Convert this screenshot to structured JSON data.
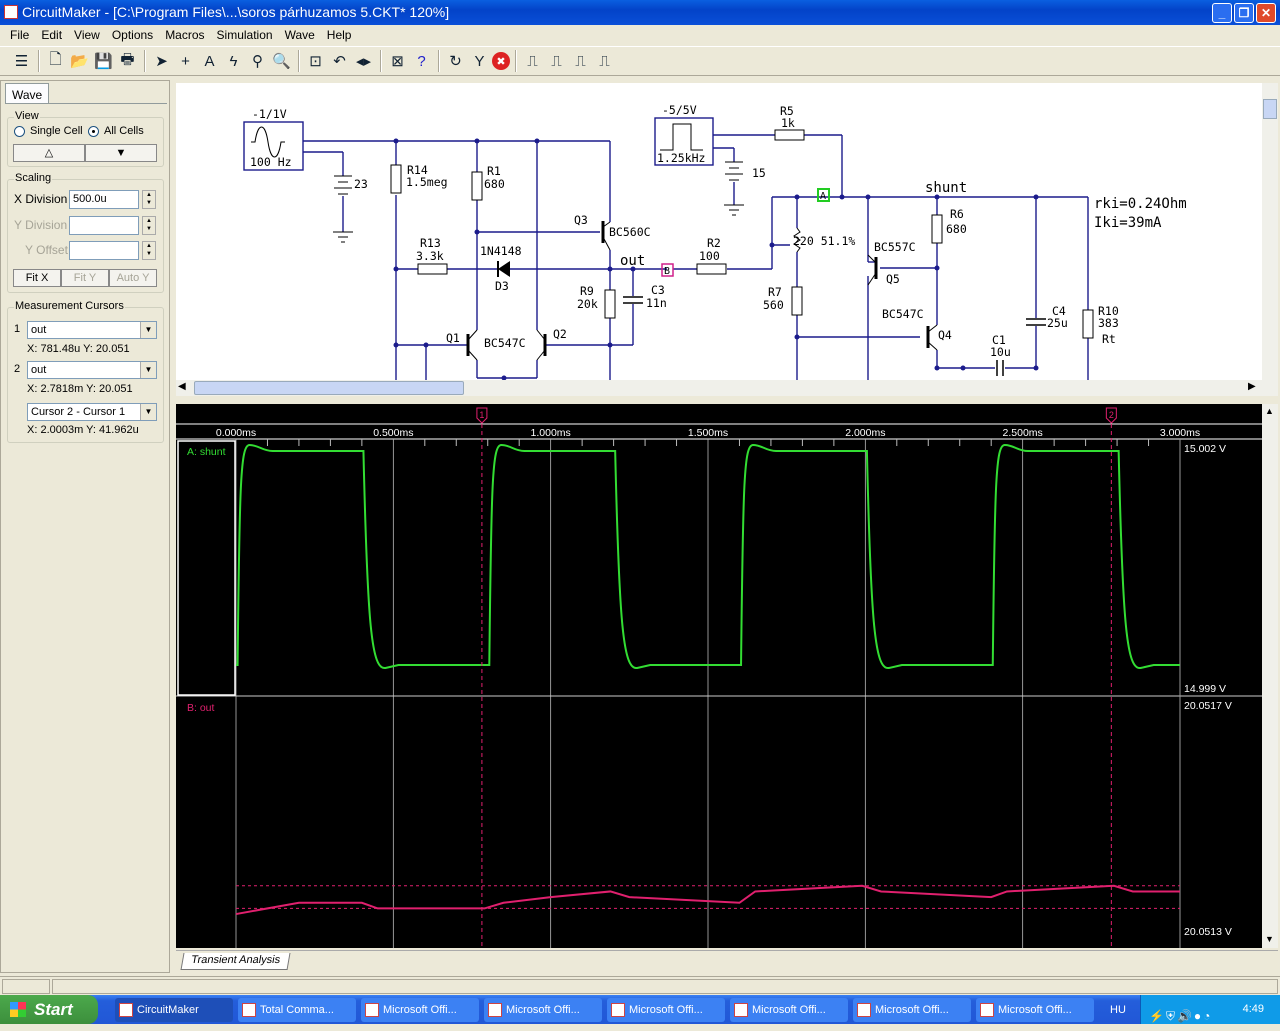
{
  "window": {
    "title": "CircuitMaker - [C:\\Program Files\\...\\soros párhuzamos 5.CKT* 120%]"
  },
  "menu": [
    "File",
    "Edit",
    "View",
    "Options",
    "Macros",
    "Simulation",
    "Wave",
    "Help"
  ],
  "toolbar": [
    "parts-bin-icon",
    "|",
    "new-icon",
    "open-icon",
    "save-icon",
    "print-icon",
    "|",
    "arrow-tool-icon",
    "wire-tool-icon",
    "text-tool-icon",
    "fault-tool-icon",
    "probe-tool-icon",
    "zoom-tool-icon",
    "|",
    "zoom-fit-icon",
    "rotate-icon",
    "mirror-icon",
    "|",
    "digital-analog-icon",
    "help-icon",
    "|",
    "reset-icon",
    "step-icon",
    "stop-icon",
    "|",
    "cell-icon-1",
    "cell-icon-2",
    "cell-icon-3",
    "cell-icon-4"
  ],
  "panel": {
    "tab": "Wave",
    "view": {
      "label": "View",
      "single": "Single Cell",
      "all": "All Cells",
      "selected": "All Cells",
      "up": "△",
      "down": "▼"
    },
    "scaling": {
      "label": "Scaling",
      "xdiv_label": "X Division",
      "xdiv": "500.0u",
      "ydiv_label": "Y Division",
      "ydiv": "",
      "yoff_label": "Y Offset",
      "yoff": "",
      "fitx": "Fit X",
      "fity": "Fit Y",
      "autoy": "Auto Y"
    },
    "cursors": {
      "label": "Measurement Cursors",
      "c1": {
        "num": "1",
        "signal": "out",
        "readout": "X: 781.48u  Y: 20.051"
      },
      "c2": {
        "num": "2",
        "signal": "out",
        "readout": "X: 2.7818m  Y: 20.051"
      },
      "diff": {
        "mode": "Cursor 2 - Cursor 1",
        "readout": "X: 2.0003m  Y: 41.962u"
      }
    }
  },
  "schematic": {
    "labels": {
      "src1_amp": "-1/1V",
      "src1_freq": "100 Hz",
      "bat1": "23",
      "r14": "R14",
      "r14v": "1.5meg",
      "r1": "R1",
      "r1v": "680",
      "q3": "Q3",
      "q3t": "BC560C",
      "r13": "R13",
      "r13v": "3.3k",
      "d3t": "1N4148",
      "d3": "D3",
      "out": "out",
      "probeB": "B",
      "r2": "R2",
      "r2v": "100",
      "r9": "R9",
      "r9v": "20k",
      "c3": "C3",
      "c3v": "11n",
      "q1": "Q1",
      "q12t": "BC547C",
      "q2": "Q2",
      "src2_amp": "-5/5V",
      "src2_freq": "1.25kHz",
      "bat2": "15",
      "r5": "R5",
      "r5v": "1k",
      "probeA": "A",
      "shunt": "shunt",
      "pot": "220 51.1%",
      "r6": "R6",
      "r6v": "680",
      "q5t": "BC557C",
      "q5": "Q5",
      "r7": "R7",
      "r7v": "560",
      "q4t": "BC547C",
      "q4": "Q4",
      "c1": "C1",
      "c1v": "10u",
      "c4": "C4",
      "c4v": "25u",
      "r10": "R10",
      "r10v": "383",
      "rt": "Rt",
      "rki": "rki=0.24Ohm",
      "iki": "Iki=39mA"
    },
    "wire_color": "#1c1c8c",
    "net_label_color": "#a0203c"
  },
  "waveform": {
    "xaxis": {
      "unit": "ms",
      "ticks": [
        "0.000ms",
        "0.500ms",
        "1.000ms",
        "1.500ms",
        "2.000ms",
        "2.500ms",
        "3.000ms"
      ],
      "range": [
        0,
        3.0
      ]
    },
    "cursor_markers": [
      "1",
      "2"
    ],
    "cursor_x_ms": [
      0.78148,
      2.7818
    ],
    "channelA": {
      "label": "A: shunt",
      "color": "#33dd33",
      "ymax": "15.002 V",
      "ymin": "14.999 V",
      "period_ms": 0.8,
      "duty": 0.5,
      "first_rise_ms": 0.005
    },
    "channelB": {
      "label": "B: out",
      "color": "#e0206e",
      "ymax": "20.0517 V",
      "ymin": "20.0513 V",
      "range": [
        20.0513,
        20.0517
      ],
      "points": [
        [
          0,
          20.05133
        ],
        [
          0.2,
          20.05135
        ],
        [
          0.4,
          20.05135
        ],
        [
          0.45,
          20.05134
        ],
        [
          0.79,
          20.05134
        ],
        [
          0.85,
          20.05135
        ],
        [
          1.0,
          20.05136
        ],
        [
          1.19,
          20.05137
        ],
        [
          1.25,
          20.05136
        ],
        [
          1.6,
          20.05135
        ],
        [
          1.65,
          20.05137
        ],
        [
          1.99,
          20.05138
        ],
        [
          2.05,
          20.05137
        ],
        [
          2.4,
          20.05136
        ],
        [
          2.45,
          20.05137
        ],
        [
          2.79,
          20.05138
        ],
        [
          2.85,
          20.05137
        ],
        [
          3.0,
          20.05137
        ]
      ],
      "cursor_levels": [
        20.05138,
        20.05134
      ]
    }
  },
  "bottom_tab": "Transient Analysis",
  "taskbar": {
    "start": "Start",
    "items": [
      "CircuitMaker",
      "Total Comma...",
      "Microsoft Offi...",
      "Microsoft Offi...",
      "Microsoft Offi...",
      "Microsoft Offi...",
      "Microsoft Offi...",
      "Microsoft Offi..."
    ],
    "lang": "HU",
    "clock": "4:49"
  }
}
